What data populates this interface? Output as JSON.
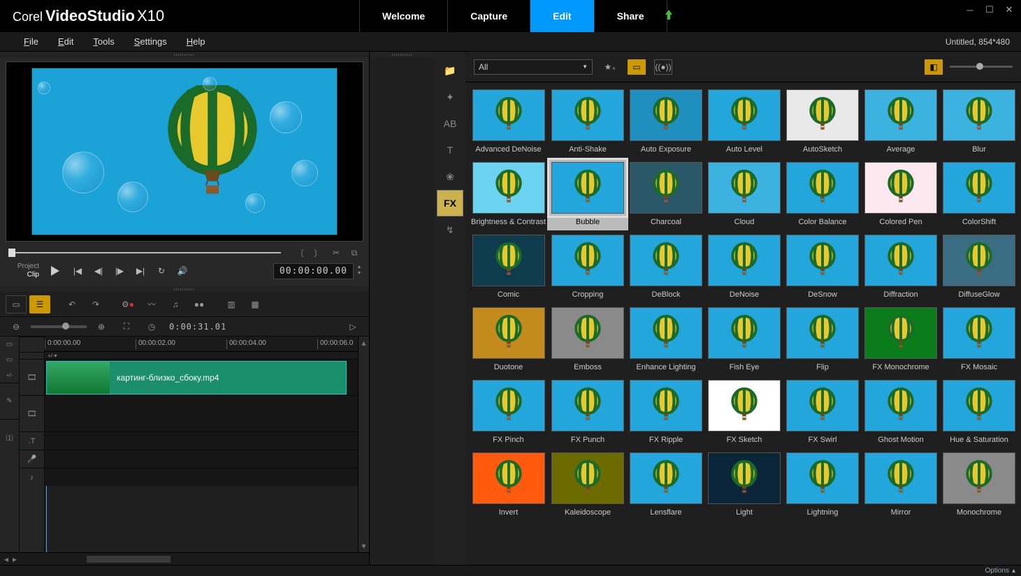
{
  "app": {
    "brand": "Corel",
    "product": "VideoStudio",
    "version": "X10"
  },
  "main_tabs": [
    "Welcome",
    "Capture",
    "Edit",
    "Share"
  ],
  "main_tab_active": 2,
  "menu": [
    "File",
    "Edit",
    "Tools",
    "Settings",
    "Help"
  ],
  "project_info": "Untitled, 854*480",
  "preview": {
    "mode_labels": {
      "project": "Project",
      "clip": "Clip"
    },
    "timecode": "00:00:00.00"
  },
  "timeline": {
    "duration_tc": "0:00:31.01",
    "ruler": [
      "0:00:00.00",
      "00:00:02.00",
      "00:00:04.00",
      "00:00:06.0"
    ],
    "ruler_sub": "+/-▾",
    "clip_name": "картинг-близко_сбоку.mp4",
    "track_icons": [
      "film-icon",
      "film-icon",
      "title-track-icon",
      "voice-track-icon",
      "music-track-icon"
    ],
    "gutter_icons": [
      "storyboard-icon",
      "storyboard-plus-icon",
      "edit-track-icon",
      "numeric-track-icon"
    ]
  },
  "library": {
    "combo_value": "All",
    "sidebar": [
      {
        "name": "media-icon",
        "glyph": "📁"
      },
      {
        "name": "transition-icon",
        "glyph": "✦"
      },
      {
        "name": "title-icon",
        "glyph": "AB"
      },
      {
        "name": "graphic-icon",
        "glyph": "T"
      },
      {
        "name": "filter-icon",
        "glyph": "❀"
      },
      {
        "name": "fx-icon",
        "glyph": "FX",
        "active": true
      },
      {
        "name": "path-icon",
        "glyph": "↯"
      }
    ],
    "effects": [
      {
        "label": "Advanced DeNoise",
        "bg": "#22a6dc"
      },
      {
        "label": "Anti-Shake",
        "bg": "#22a6dc"
      },
      {
        "label": "Auto Exposure",
        "bg": "#1e8fbf"
      },
      {
        "label": "Auto Level",
        "bg": "#22a6dc"
      },
      {
        "label": "AutoSketch",
        "bg": "#e9e9e9"
      },
      {
        "label": "Average",
        "bg": "#3bb2e0"
      },
      {
        "label": "Blur",
        "bg": "#3bb2e0"
      },
      {
        "label": "Brightness & Contrast",
        "bg": "#6bd3ef"
      },
      {
        "label": "Bubble",
        "bg": "#22a6dc",
        "selected": true
      },
      {
        "label": "Charcoal",
        "bg": "#2b5868"
      },
      {
        "label": "Cloud",
        "bg": "#3bb2e0"
      },
      {
        "label": "Color Balance",
        "bg": "#22a6dc"
      },
      {
        "label": "Colored Pen",
        "bg": "#fce9ef"
      },
      {
        "label": "ColorShift",
        "bg": "#22a6dc"
      },
      {
        "label": "Comic",
        "bg": "#0e3c4c"
      },
      {
        "label": "Cropping",
        "bg": "#22a6dc"
      },
      {
        "label": "DeBlock",
        "bg": "#22a6dc"
      },
      {
        "label": "DeNoise",
        "bg": "#22a6dc"
      },
      {
        "label": "DeSnow",
        "bg": "#22a6dc"
      },
      {
        "label": "Diffraction",
        "bg": "#22a6dc"
      },
      {
        "label": "DiffuseGlow",
        "bg": "#3a6d82"
      },
      {
        "label": "Duotone",
        "bg": "#c38a1c"
      },
      {
        "label": "Emboss",
        "bg": "#8a8a8a"
      },
      {
        "label": "Enhance Lighting",
        "bg": "#22a6dc"
      },
      {
        "label": "Fish Eye",
        "bg": "#22a6dc"
      },
      {
        "label": "Flip",
        "bg": "#22a6dc"
      },
      {
        "label": "FX Monochrome",
        "bg": "#0a7d1a"
      },
      {
        "label": "FX Mosaic",
        "bg": "#22a6dc"
      },
      {
        "label": "FX Pinch",
        "bg": "#22a6dc"
      },
      {
        "label": "FX Punch",
        "bg": "#22a6dc"
      },
      {
        "label": "FX Ripple",
        "bg": "#22a6dc"
      },
      {
        "label": "FX Sketch",
        "bg": "#ffffff"
      },
      {
        "label": "FX Swirl",
        "bg": "#22a6dc"
      },
      {
        "label": "Ghost Motion",
        "bg": "#22a6dc"
      },
      {
        "label": "Hue & Saturation",
        "bg": "#22a6dc"
      },
      {
        "label": "Invert",
        "bg": "#ff5a0e"
      },
      {
        "label": "Kaleidoscope",
        "bg": "#6b6b00"
      },
      {
        "label": "Lensflare",
        "bg": "#22a6dc"
      },
      {
        "label": "Light",
        "bg": "#0a2638"
      },
      {
        "label": "Lightning",
        "bg": "#22a6dc"
      },
      {
        "label": "Mirror",
        "bg": "#22a6dc"
      },
      {
        "label": "Monochrome",
        "bg": "#8a8a8a"
      }
    ]
  },
  "footer": {
    "options": "Options"
  }
}
